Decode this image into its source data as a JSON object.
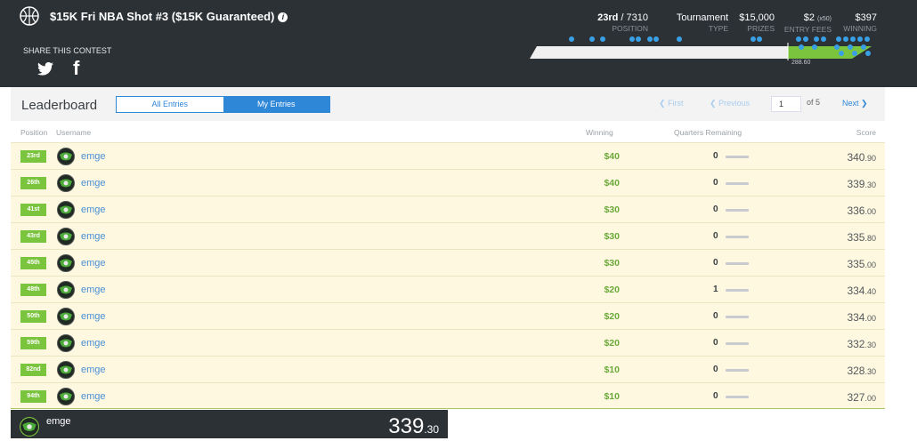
{
  "header": {
    "title": "$15K Fri NBA Shot #3 ($15K Guaranteed)",
    "share_label": "SHARE THIS CONTEST",
    "position_rank": "23rd",
    "position_total": " / 7310",
    "position_label": "POSITION",
    "type_value": "Tournament",
    "type_label": "TYPE",
    "prizes_value": "$15,000",
    "prizes_label": "PRIZES",
    "entry_fee_value": "$2",
    "entry_fee_mult": "(x50)",
    "entry_fee_label": "ENTRY FEES",
    "winning_value": "$397",
    "winning_label": "WINNING",
    "tracker_value": "288.60"
  },
  "leaderboard": {
    "title": "Leaderboard",
    "tabs": [
      "All Entries",
      "My Entries"
    ],
    "active_tab": 1,
    "pager": {
      "first": "First",
      "previous": "Previous",
      "page": "1",
      "of": "of 5",
      "next": "Next"
    }
  },
  "columns": {
    "position": "Position",
    "username": "Username",
    "winning": "Winning",
    "quarters": "Quarters Remaining",
    "score": "Score"
  },
  "rows": [
    {
      "position": "23rd",
      "username": "emge",
      "winning": "$40",
      "quarters": "0",
      "score_main": "340",
      "score_dec": ".90"
    },
    {
      "position": "26th",
      "username": "emge",
      "winning": "$40",
      "quarters": "0",
      "score_main": "339",
      "score_dec": ".30"
    },
    {
      "position": "41st",
      "username": "emge",
      "winning": "$30",
      "quarters": "0",
      "score_main": "336",
      "score_dec": ".00"
    },
    {
      "position": "43rd",
      "username": "emge",
      "winning": "$30",
      "quarters": "0",
      "score_main": "335",
      "score_dec": ".80"
    },
    {
      "position": "45th",
      "username": "emge",
      "winning": "$30",
      "quarters": "0",
      "score_main": "335",
      "score_dec": ".00"
    },
    {
      "position": "48th",
      "username": "emge",
      "winning": "$20",
      "quarters": "1",
      "score_main": "334",
      "score_dec": ".40"
    },
    {
      "position": "50th",
      "username": "emge",
      "winning": "$20",
      "quarters": "0",
      "score_main": "334",
      "score_dec": ".00"
    },
    {
      "position": "59th",
      "username": "emge",
      "winning": "$20",
      "quarters": "0",
      "score_main": "332",
      "score_dec": ".30"
    },
    {
      "position": "82nd",
      "username": "emge",
      "winning": "$10",
      "quarters": "0",
      "score_main": "328",
      "score_dec": ".30"
    },
    {
      "position": "94th",
      "username": "emge",
      "winning": "$10",
      "quarters": "0",
      "score_main": "327",
      "score_dec": ".00"
    }
  ],
  "footer": {
    "username": "emge",
    "score_main": "339",
    "score_dec": ".30"
  },
  "colors": {
    "header_bg": "#2c3136",
    "accent_blue": "#2f87d8",
    "badge_green": "#7bc53e",
    "winning_green": "#6ba93a",
    "row_bg": "#fdf8df"
  }
}
